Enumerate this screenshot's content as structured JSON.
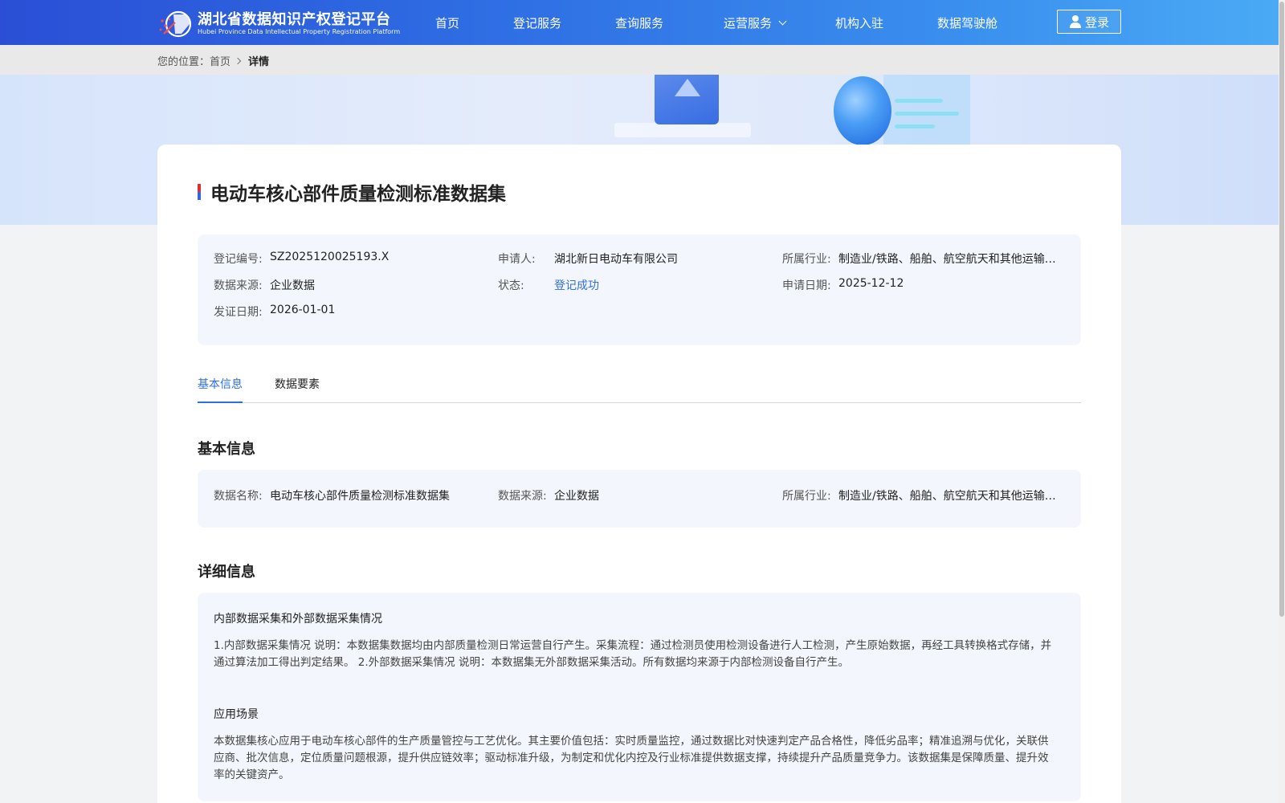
{
  "header": {
    "logo_cn": "湖北省数据知识产权登记平台",
    "logo_en": "Hubei Province Data Intellectual Property Registration Platform",
    "nav": [
      {
        "label": "首页"
      },
      {
        "label": "登记服务"
      },
      {
        "label": "查询服务"
      },
      {
        "label": "运营服务"
      },
      {
        "label": "机构入驻"
      },
      {
        "label": "数据驾驶舱"
      }
    ],
    "login_label": "登录"
  },
  "breadcrumb": {
    "prefix": "您的位置：",
    "home": "首页",
    "current": "详情"
  },
  "detail": {
    "title": "电动车核心部件质量检测标准数据集",
    "summary": {
      "reg_no_label": "登记编号:",
      "reg_no": "SZ2025120025193.X",
      "applicant_label": "申请人:",
      "applicant": "湖北新日电动车有限公司",
      "industry_label": "所属行业:",
      "industry": "制造业/铁路、船舶、航空航天和其他运输设备制造业",
      "source_label": "数据来源:",
      "source": "企业数据",
      "status_label": "状态:",
      "status": "登记成功",
      "apply_date_label": "申请日期:",
      "apply_date": "2025-12-12",
      "issue_date_label": "发证日期:",
      "issue_date": "2026-01-01"
    },
    "tabs": [
      {
        "label": "基本信息"
      },
      {
        "label": "数据要素"
      }
    ],
    "basic": {
      "section_title": "基本信息",
      "name_label": "数据名称:",
      "name": "电动车核心部件质量检测标准数据集",
      "source_label": "数据来源:",
      "source": "企业数据",
      "industry_label": "所属行业:",
      "industry": "制造业/铁路、船舶、航空航天和其他运输设备制造业"
    },
    "details": {
      "section_title": "详细信息",
      "collection_title": "内部数据采集和外部数据采集情况",
      "collection_text": "1.内部数据采集情况 说明：本数据集数据均由内部质量检测日常运营自行产生。采集流程：通过检测员使用检测设备进行人工检测，产生原始数据，再经工具转换格式存储，并通过算法加工得出判定结果。 2.外部数据采集情况 说明：本数据集无外部数据采集活动。所有数据均来源于内部检测设备自行产生。",
      "scenario_title": "应用场景",
      "scenario_text": "本数据集核心应用于电动车核心部件的生产质量管控与工艺优化。其主要价值包括：实时质量监控，通过数据比对快速判定产品合格性，降低劣品率；精准追溯与优化，关联供应商、批次信息，定位质量问题根源，提升供应链效率；驱动标准升级，为制定和优化内控及行业标准提供数据支撑，持续提升产品质量竞争力。该数据集是保障质量、提升效率的关键资产。"
    }
  }
}
